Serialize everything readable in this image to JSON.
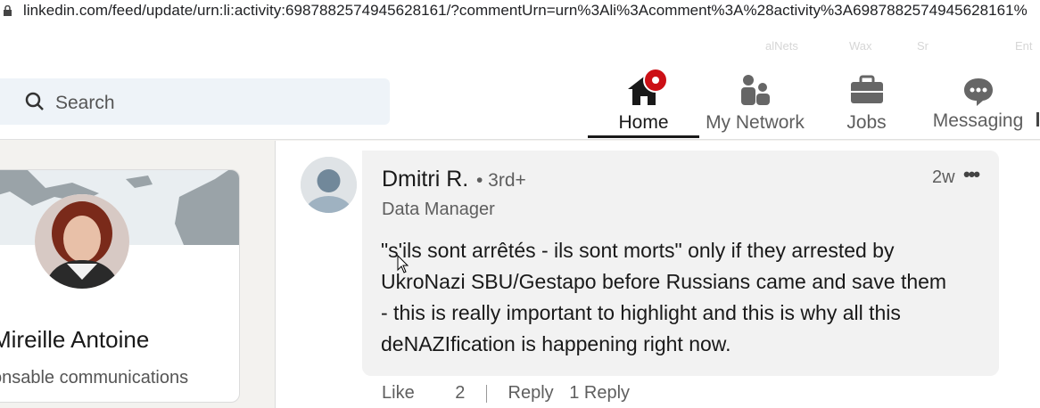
{
  "browser": {
    "url": "linkedin.com/feed/update/urn:li:activity:6987882574945628161/?commentUrn=urn%3Ali%3Acomment%3A%28activity%3A6987882574945628161%"
  },
  "bookmarks": [
    "alNets",
    "Wax",
    "Sr",
    "Ent"
  ],
  "nav": {
    "search_placeholder": "Search",
    "items": [
      {
        "label": "Home",
        "icon": "home-icon",
        "active": true
      },
      {
        "label": "My Network",
        "icon": "my-network-icon"
      },
      {
        "label": "Jobs",
        "icon": "briefcase-icon"
      },
      {
        "label": "Messaging",
        "icon": "messaging-icon"
      }
    ]
  },
  "profile": {
    "name": "Mireille Antoine",
    "headline": "onsable communications"
  },
  "comment": {
    "author": "Dmitri R.",
    "degree": "• 3rd+",
    "title": "Data Manager",
    "time": "2w",
    "more": "•••",
    "lines": [
      "\"s'ils sont arrêtés - ils sont morts\" only if they arrested by",
      "UkroNazi SBU/Gestapo before Russians came and save them",
      "- this is really important to highlight and this is why all this",
      "deNAZIfication is happening right now."
    ],
    "actions": {
      "like": "Like",
      "reactions": "2",
      "reply": "Reply",
      "replies": "1 Reply"
    }
  },
  "colors": {
    "accent": "#cc1016",
    "search_bg": "#eef3f8",
    "bubble_bg": "#f2f2f2"
  }
}
